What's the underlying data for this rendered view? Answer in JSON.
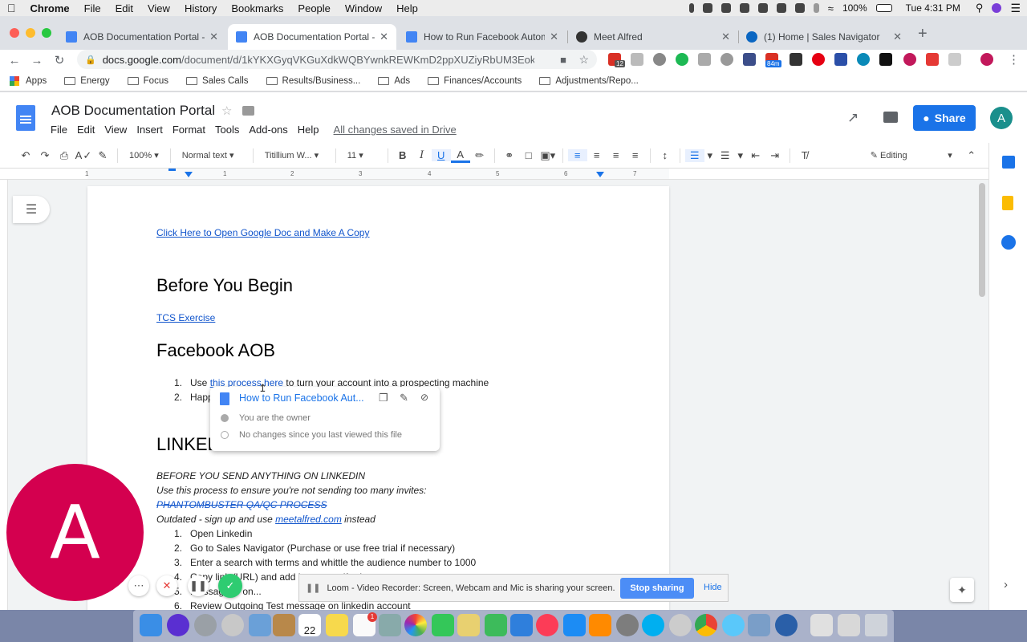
{
  "menubar": {
    "app": "Chrome",
    "items": [
      "File",
      "Edit",
      "View",
      "History",
      "Bookmarks",
      "People",
      "Window",
      "Help"
    ],
    "battery": "100%",
    "clock": "Tue 4:31 PM"
  },
  "tabs": [
    {
      "title": "AOB Documentation Portal - G",
      "active": false
    },
    {
      "title": "AOB Documentation Portal - G",
      "active": true
    },
    {
      "title": "How to Run Facebook Automat",
      "active": false
    },
    {
      "title": "Meet Alfred",
      "active": false
    },
    {
      "title": "(1) Home | Sales Navigator",
      "active": false
    }
  ],
  "address": {
    "host": "docs.google.com",
    "path": "/document/d/1kYKXGyqVKGuXdkWQBYwnkREWKmD2ppXUZiyRbUM3Eok/..."
  },
  "extensions": {
    "badge1": "12",
    "badge2": "84m"
  },
  "bookmarks": [
    "Apps",
    "Energy",
    "Focus",
    "Sales Calls",
    "Results/Business...",
    "Ads",
    "Finances/Accounts",
    "Adjustments/Repo..."
  ],
  "doc": {
    "title": "AOB Documentation Portal",
    "menu": [
      "File",
      "Edit",
      "View",
      "Insert",
      "Format",
      "Tools",
      "Add-ons",
      "Help"
    ],
    "saved": "All changes saved in Drive",
    "share": "Share",
    "avatar": "A"
  },
  "format": {
    "zoom": "100%",
    "style": "Normal text",
    "font": "Titillium W...",
    "size": "11",
    "mode": "Editing"
  },
  "ruler": [
    "1",
    "1",
    "2",
    "3",
    "4",
    "5",
    "6",
    "7"
  ],
  "content": {
    "copy_link": "Click Here to Open Google Doc and Make A Copy",
    "h_before": "Before You Begin",
    "tcs": "TCS Exercise",
    "h_fb": "Facebook AOB",
    "fb_item1_pre": "Use ",
    "fb_item1_link": "this process here",
    "fb_item1_post": " to turn your account into a prospecting machine",
    "fb_item2": "Happ",
    "h_linkedin": "LINKED",
    "li_warn": "BEFORE YOU SEND ANYTHING ON LINKEDIN",
    "li_use": "Use this process to ensure you're not sending too many invites:",
    "li_phantom": "PHANTOMBUSTER QA/QC PROCESS",
    "li_outdated_pre": "Outdated - sign up and use ",
    "li_outdated_link": "meetalfred.com",
    "li_outdated_post": " instead",
    "steps": [
      "Open Linkedin",
      "Go to Sales Navigator (Purchase or use free trial if necessary)",
      "Enter a search with terms and whittle the audience number to 1000",
      "Copy link (URL) and add it to meetalfred.com",
      "...essage to on...",
      "Review Outgoing Test message on linkedin account"
    ]
  },
  "linkpopup": {
    "title": "How to Run Facebook Aut...",
    "owner": "You are the owner",
    "changes": "No changes since you last viewed this file"
  },
  "loom": {
    "avatar": "A",
    "message": "Loom - Video Recorder: Screen, Webcam and Mic is sharing your screen.",
    "stop": "Stop sharing",
    "hide": "Hide"
  },
  "dock": {
    "calendar_day": "22",
    "badge": "1"
  },
  "colors": {
    "link": "#1155cc",
    "share": "#1a73e8",
    "loom": "#d4004f",
    "stop": "#4c8df6"
  }
}
